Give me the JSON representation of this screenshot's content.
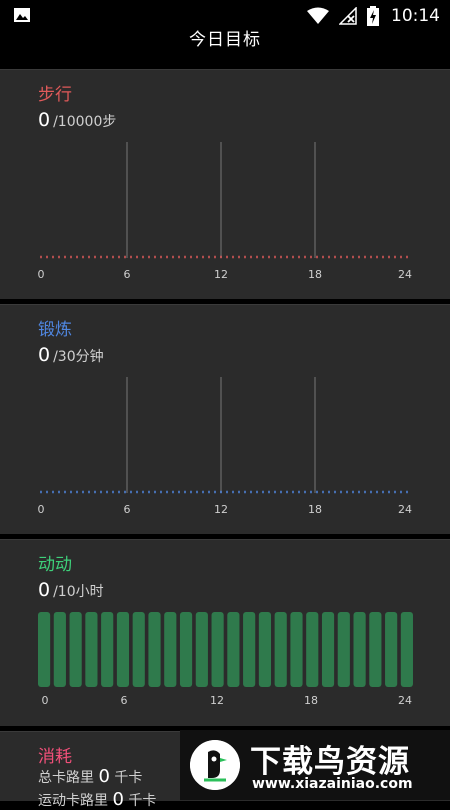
{
  "statusbar": {
    "time": "10:14"
  },
  "header": {
    "title": "今日目标"
  },
  "steps": {
    "title": "步行",
    "value": "0",
    "goal": "/10000步",
    "color": "#e05a5a"
  },
  "exercise": {
    "title": "锻炼",
    "value": "0",
    "goal": "/30分钟",
    "color": "#4f86e0"
  },
  "active": {
    "title": "动动",
    "value": "0",
    "goal": "/10小时",
    "color": "#3ed07a"
  },
  "calories": {
    "title": "消耗",
    "total_label": "总卡路里",
    "total_value": "0",
    "total_unit": "千卡",
    "active_label": "运动卡路里",
    "active_value": "0",
    "active_unit": "千卡",
    "color": "#f2507a"
  },
  "axis_labels": [
    "0",
    "6",
    "12",
    "18",
    "24"
  ],
  "promo": {
    "title": "下载鸟资源",
    "url": "www.xiazainiao.com"
  },
  "chart_data": [
    {
      "type": "line",
      "series": [
        {
          "name": "步行",
          "values": []
        }
      ],
      "x_ticks": [
        "0",
        "6",
        "12",
        "18",
        "24"
      ],
      "xlim": [
        0,
        24
      ]
    },
    {
      "type": "line",
      "series": [
        {
          "name": "锻炼",
          "values": []
        }
      ],
      "x_ticks": [
        "0",
        "6",
        "12",
        "18",
        "24"
      ],
      "xlim": [
        0,
        24
      ]
    },
    {
      "type": "bar",
      "series": [
        {
          "name": "动动",
          "values": [
            0,
            0,
            0,
            0,
            0,
            0,
            0,
            0,
            0,
            0,
            0,
            0,
            0,
            0,
            0,
            0,
            0,
            0,
            0,
            0,
            0,
            0,
            0,
            0
          ]
        }
      ],
      "x_ticks": [
        "0",
        "6",
        "12",
        "18",
        "24"
      ],
      "xlim": [
        0,
        24
      ]
    }
  ]
}
